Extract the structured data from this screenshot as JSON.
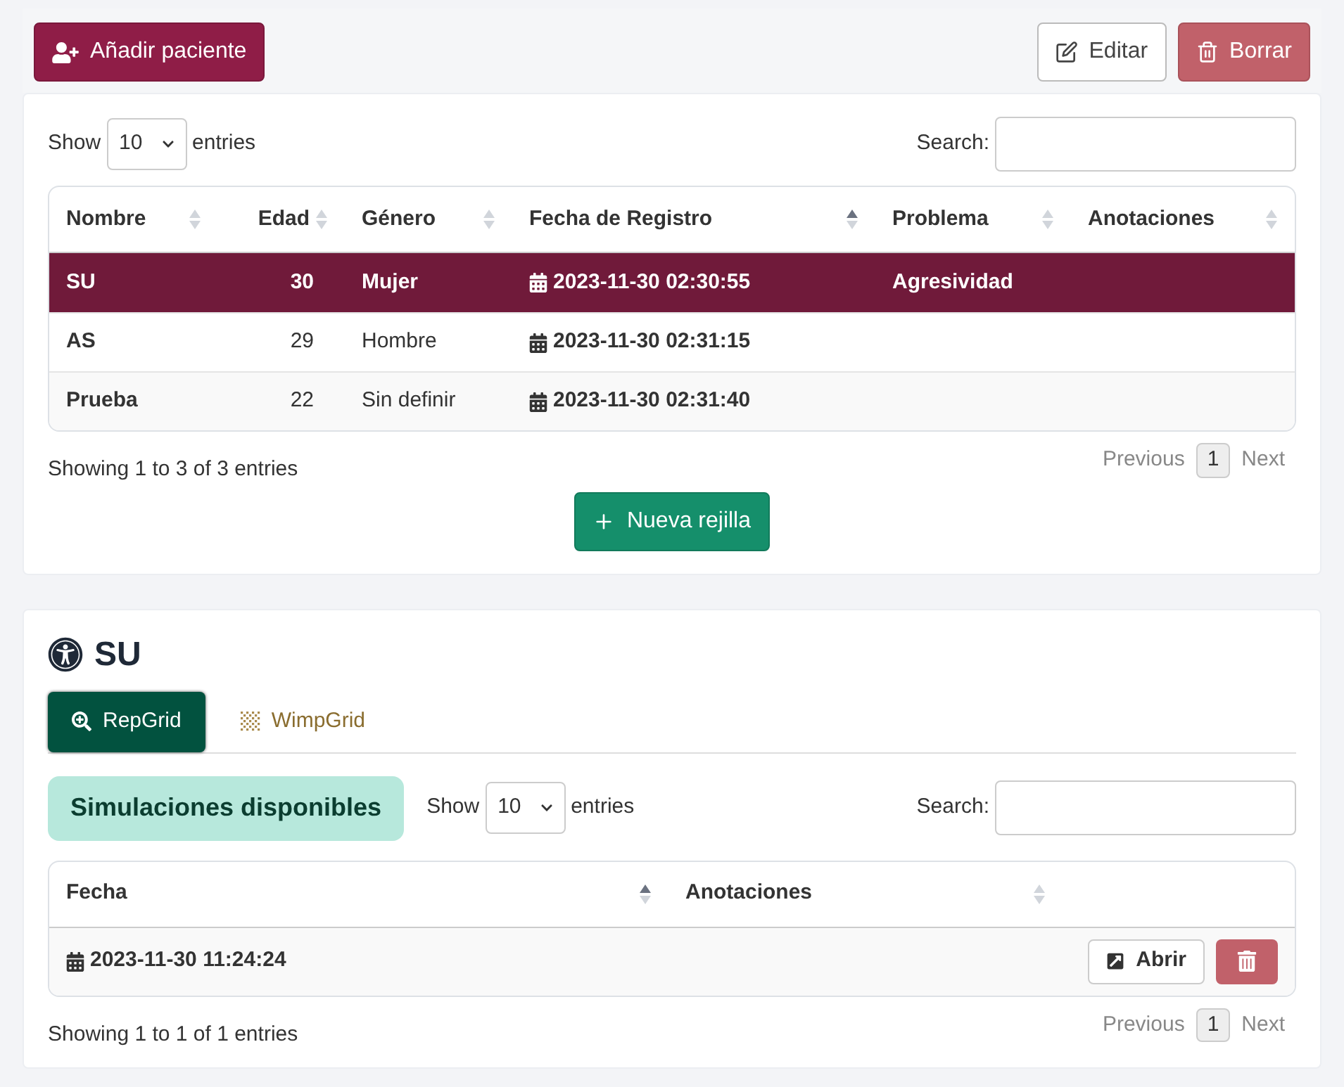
{
  "toolbar": {
    "add_button": "Añadir paciente",
    "edit_button": "Editar",
    "delete_button": "Borrar"
  },
  "patients": {
    "length_label_before": "Show",
    "length_value": "10",
    "length_label_after": "entries",
    "search_label": "Search:",
    "columns": [
      {
        "label": "Nombre",
        "sorted": false,
        "numeric": false
      },
      {
        "label": "Edad",
        "sorted": false,
        "numeric": true
      },
      {
        "label": "Género",
        "sorted": false,
        "numeric": false
      },
      {
        "label": "Fecha de Registro",
        "sorted": true,
        "numeric": false
      },
      {
        "label": "Problema",
        "sorted": false,
        "numeric": false
      },
      {
        "label": "Anotaciones",
        "sorted": false,
        "numeric": false
      }
    ],
    "rows": [
      {
        "selected": true,
        "cells": [
          "SU",
          "30",
          "Mujer",
          "2023-11-30 02:30:55",
          "Agresividad",
          ""
        ]
      },
      {
        "selected": false,
        "cells": [
          "AS",
          "29",
          "Hombre",
          "2023-11-30 02:31:15",
          "",
          ""
        ]
      },
      {
        "selected": false,
        "cells": [
          "Prueba",
          "22",
          "Sin definir",
          "2023-11-30 02:31:40",
          "",
          ""
        ]
      }
    ],
    "info": "Showing 1 to 3 of 3 entries",
    "pager": {
      "previous": "Previous",
      "page": "1",
      "next": "Next"
    },
    "new_button": "Nueva rejilla"
  },
  "detail": {
    "title": "SU",
    "tabs": [
      {
        "label": "RepGrid",
        "selected": true
      },
      {
        "label": "WimpGrid",
        "selected": false
      }
    ],
    "badge": "Simulaciones disponibles",
    "length_label_before": "Show",
    "length_value": "10",
    "length_label_after": "entries",
    "search_label": "Search:",
    "columns": [
      {
        "label": "Fecha",
        "sorted": true
      },
      {
        "label": "Anotaciones",
        "sorted": false
      }
    ],
    "rows": [
      {
        "date": "2023-11-30 11:24:24",
        "open_button": "Abrir"
      }
    ],
    "info": "Showing 1 to 1 of 1 entries",
    "pager": {
      "previous": "Previous",
      "page": "1",
      "next": "Next"
    }
  }
}
